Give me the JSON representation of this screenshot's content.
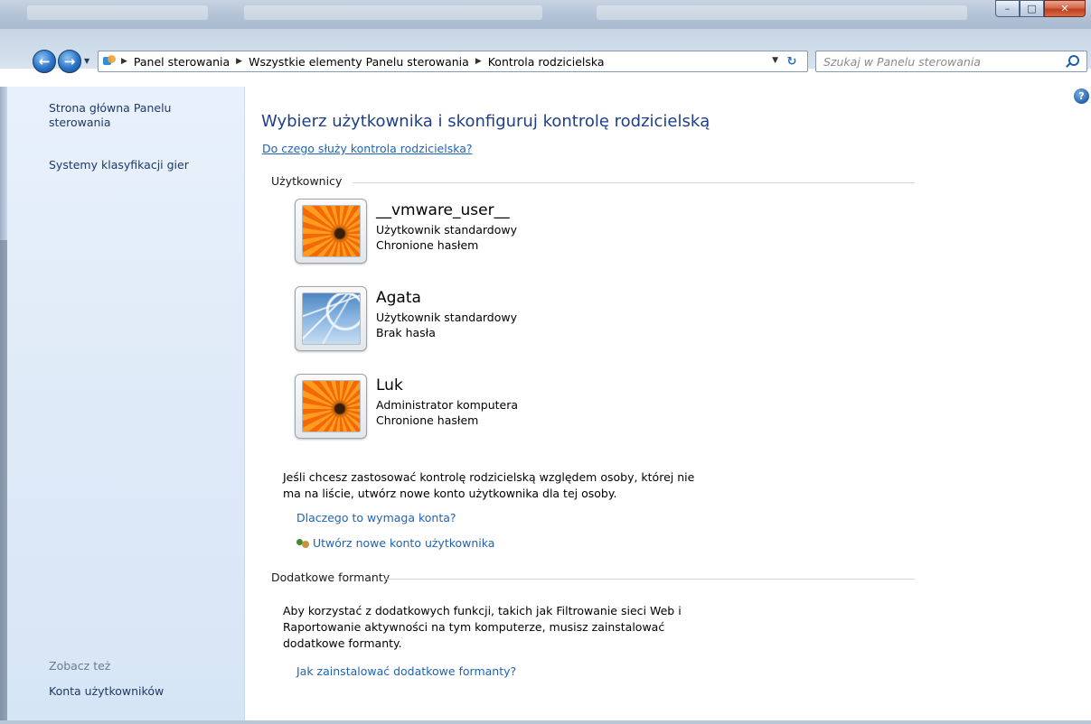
{
  "window": {
    "minimize": "–",
    "maximize": "□",
    "close": "✕"
  },
  "nav": {
    "back_icon": "arrow-left-icon",
    "forward_icon": "arrow-right-icon",
    "dropdown": "▼"
  },
  "address": {
    "crumbs": [
      "Panel sterowania",
      "Wszystkie elementy Panelu sterowania",
      "Kontrola rodzicielska"
    ],
    "separator": "▶",
    "dropdown": "▼",
    "refresh": "↻"
  },
  "search": {
    "placeholder": "Szukaj w Panelu sterowania"
  },
  "sidebar": {
    "home_line1": "Strona główna Panelu",
    "home_line2": "sterowania",
    "games": "Systemy klasyfikacji gier",
    "see_also": "Zobacz też",
    "accounts": "Konta użytkowników"
  },
  "main": {
    "help": "?",
    "title": "Wybierz użytkownika i skonfiguruj kontrolę rodzicielską",
    "what_link": "Do czego służy kontrola rodzicielska?",
    "users_section": "Użytkownicy",
    "users": [
      {
        "name": "__vmware_user__",
        "type": "Użytkownik standardowy",
        "password": "Chronione hasłem",
        "picture": "flower"
      },
      {
        "name": "Agata",
        "type": "Użytkownik standardowy",
        "password": "Brak hasła",
        "picture": "coaster"
      },
      {
        "name": "Luk",
        "type": "Administrator komputera",
        "password": "Chronione hasłem",
        "picture": "flower"
      }
    ],
    "info_line1": "Jeśli chcesz zastosować kontrolę rodzicielską względem osoby, której nie",
    "info_line2": "ma na liście, utwórz nowe konto użytkownika dla tej osoby.",
    "why_link": "Dlaczego to wymaga konta?",
    "create_link": "Utwórz nowe konto użytkownika",
    "extra_section": "Dodatkowe formanty",
    "extra_line1": "Aby korzystać z dodatkowych funkcji, takich jak Filtrowanie sieci Web i",
    "extra_line2": "Raportowanie aktywności na tym komputerze, musisz zainstalować",
    "extra_line3": "dodatkowe formanty.",
    "install_link": "Jak zainstalować dodatkowe formanty?"
  }
}
